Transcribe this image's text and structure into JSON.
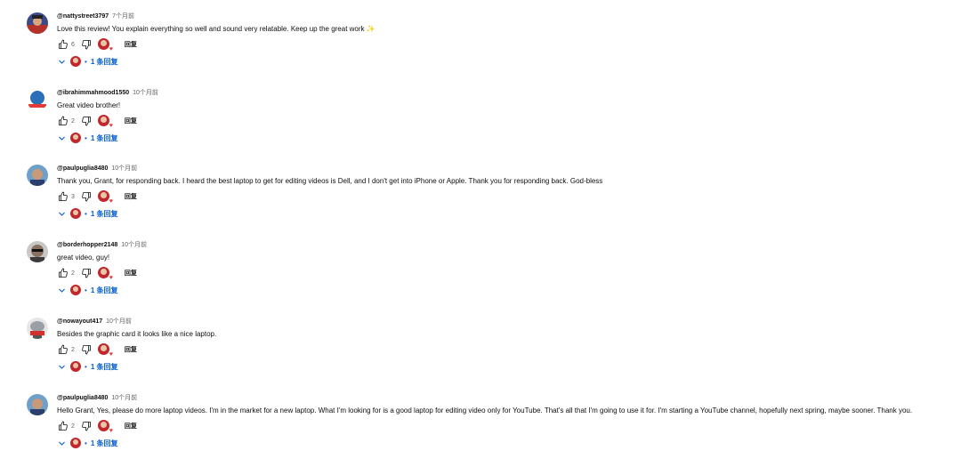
{
  "comments": [
    {
      "author": "@nattystreet3797",
      "time": "7个月前",
      "text": "Love this review! You explain everything so well and sound very relatable. Keep up the great work ✨",
      "likes": "6",
      "reply_label": "回复",
      "replies_label": "1 条回复",
      "avatar_color": "#3b4a8a"
    },
    {
      "author": "@ibrahimmahmood1550",
      "time": "10个月前",
      "text": "Great video brother!",
      "likes": "2",
      "reply_label": "回复",
      "replies_label": "1 条回复",
      "avatar_color": "#2a6fb8"
    },
    {
      "author": "@paulpuglia8480",
      "time": "10个月前",
      "text": "Thank you, Grant, for responding back. I heard the best laptop to get for editing videos is Dell, and I don't get into iPhone or Apple. Thank you for responding back. God-bless",
      "likes": "3",
      "reply_label": "回复",
      "replies_label": "1 条回复",
      "avatar_color": "#3d6fa0"
    },
    {
      "author": "@borderhopper2148",
      "time": "10个月前",
      "text": "great video, guy!",
      "likes": "2",
      "reply_label": "回复",
      "replies_label": "1 条回复",
      "avatar_color": "#8d8d8d"
    },
    {
      "author": "@nowayout417",
      "time": "10个月前",
      "text": "Besides the graphic card it looks like a nice laptop.",
      "likes": "2",
      "reply_label": "回复",
      "replies_label": "1 条回复",
      "avatar_color": "#9aa0a6"
    },
    {
      "author": "@paulpuglia8480",
      "time": "10个月前",
      "text": "Hello Grant, Yes, please do more laptop videos. I'm in the market for a new laptop. What I'm looking for is a good laptop for editing video only for YouTube. That's all that I'm going to use it for. I'm starting a YouTube channel, hopefully next spring, maybe sooner. Thank you.",
      "likes": "2",
      "reply_label": "回复",
      "replies_label": "1 条回复",
      "avatar_color": "#3d6fa0"
    }
  ],
  "colors": {
    "link_blue": "#065fd4",
    "muted": "#606060",
    "creator_red": "#c0282d"
  }
}
